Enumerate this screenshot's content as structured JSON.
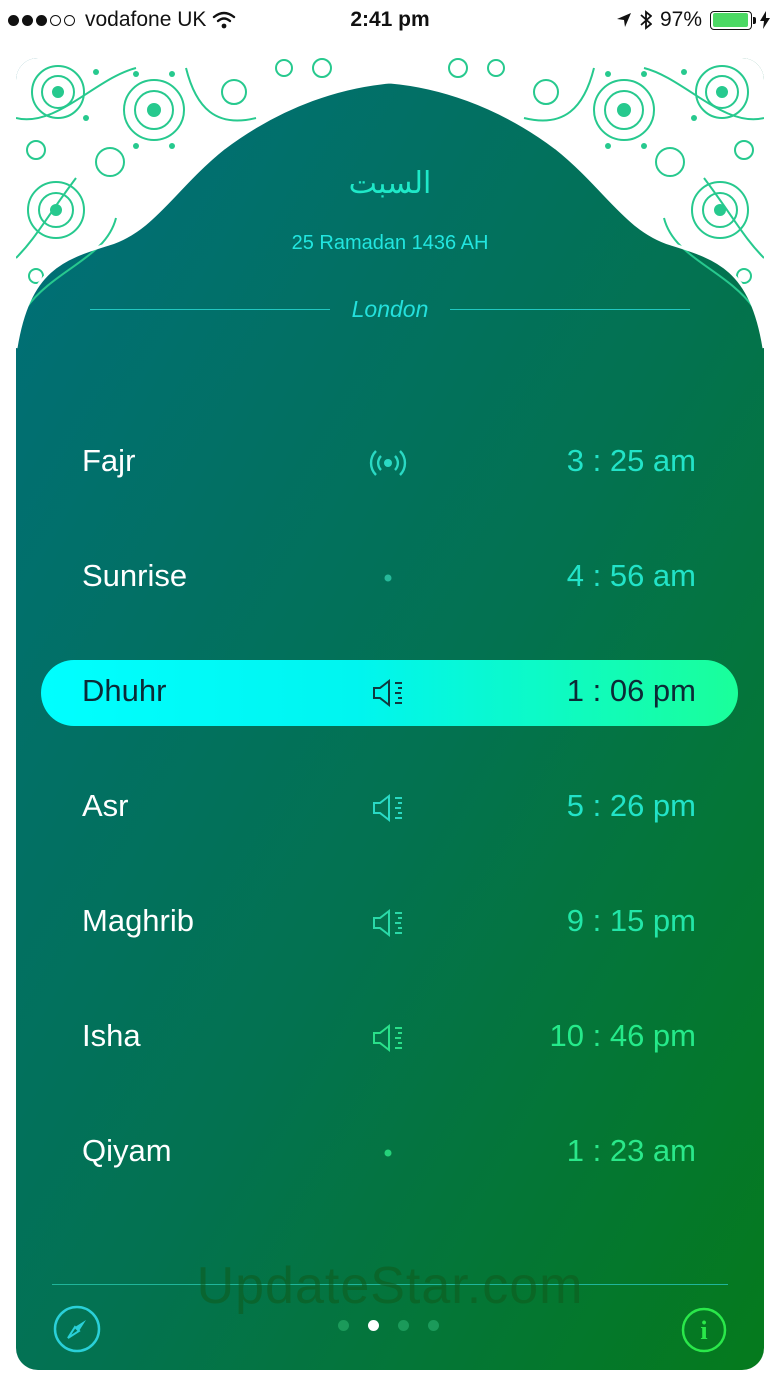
{
  "status_bar": {
    "carrier": "vodafone UK",
    "time": "2:41 pm",
    "battery_percent": "97%",
    "signal_bars_filled": 3,
    "signal_bars_total": 5,
    "battery_level": 0.97
  },
  "header": {
    "weekday_arabic": "السبت",
    "hijri_date": "25 Ramadan 1436 AH",
    "city": "London"
  },
  "prayers": [
    {
      "name": "Fajr",
      "icon": "broadcast-icon",
      "time": "3 : 25 am"
    },
    {
      "name": "Sunrise",
      "icon": "dot-icon",
      "time": "4 : 56 am"
    },
    {
      "name": "Dhuhr",
      "icon": "speaker-icon",
      "time": "1 : 06 pm",
      "active": true
    },
    {
      "name": "Asr",
      "icon": "speaker-icon",
      "time": "5 : 26 pm"
    },
    {
      "name": "Maghrib",
      "icon": "speaker-icon",
      "time": "9 : 15 pm"
    },
    {
      "name": "Isha",
      "icon": "speaker-icon",
      "time": "10 : 46 pm"
    },
    {
      "name": "Qiyam",
      "icon": "dot-icon",
      "time": "1 : 23 am"
    }
  ],
  "footer": {
    "page_count": 4,
    "current_page": 2,
    "watermark": "UpdateStar.com"
  },
  "colors": {
    "card_top": "#006b76",
    "card_bottom": "#04781e",
    "accent": "#22e3c8",
    "highlight_start": "#00ffff",
    "highlight_end": "#1aff9a"
  }
}
